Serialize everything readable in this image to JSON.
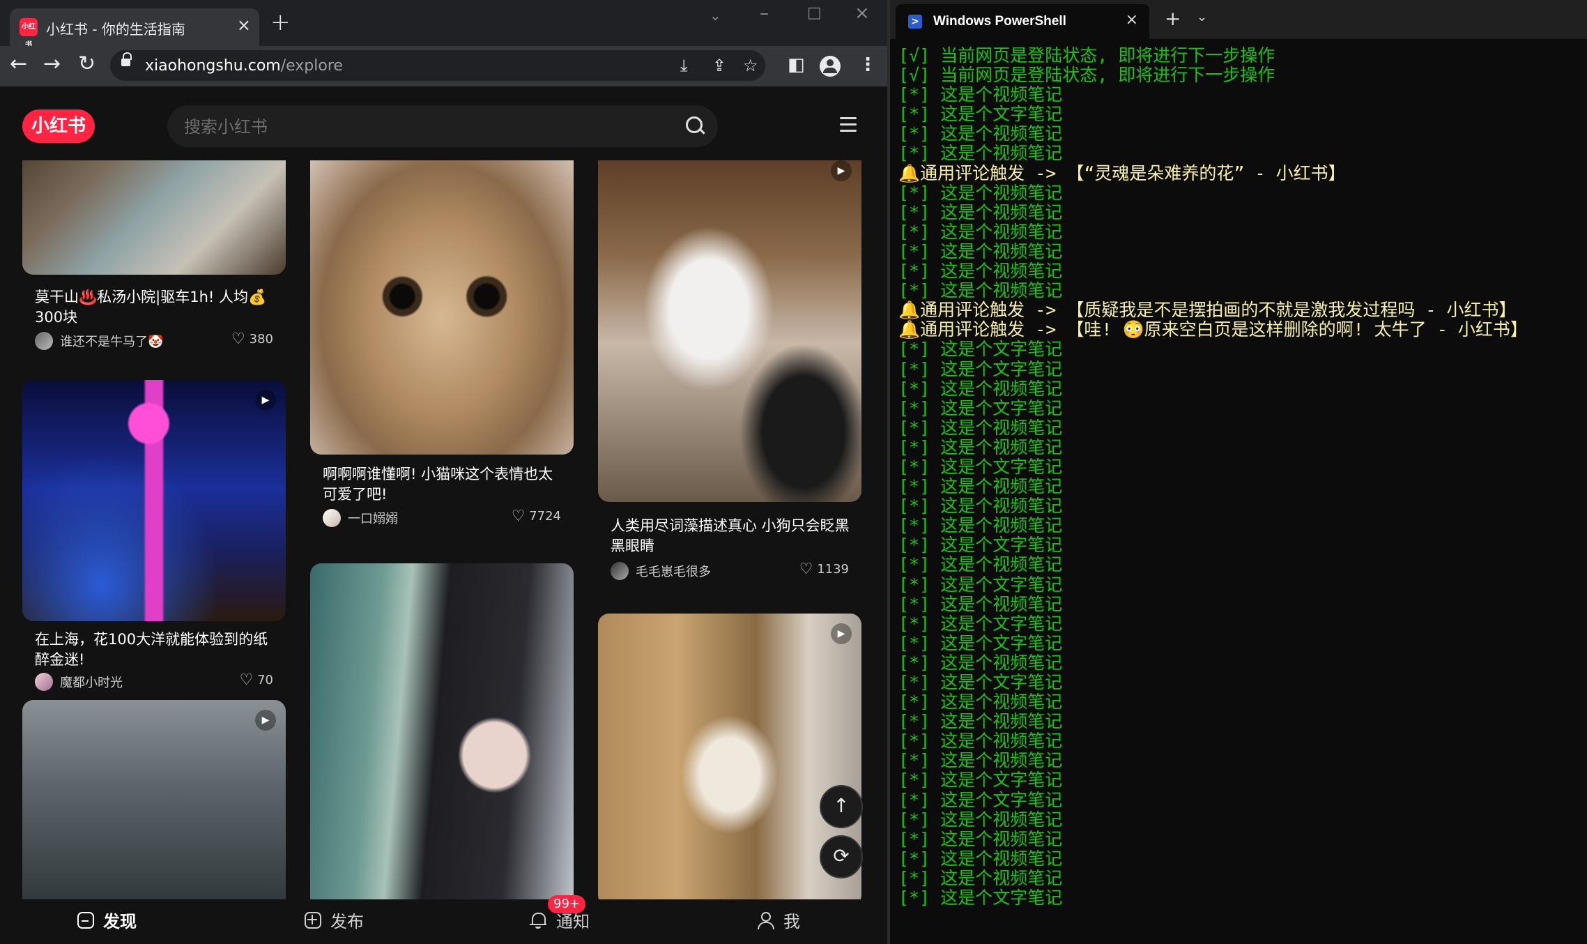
{
  "browser": {
    "tab_title": "小红书 - 你的生活指南",
    "tab_favicon_text": "小红书",
    "url_host": "xiaohongshu.com",
    "url_path": "/explore",
    "icons": [
      "back-icon",
      "forward-icon",
      "reload-icon",
      "lock-icon",
      "install-icon",
      "share-icon",
      "star-icon",
      "sidepanel-icon",
      "profile-icon",
      "more-icon"
    ]
  },
  "xhs": {
    "logo": "小红书",
    "search_placeholder": "搜索小红书",
    "brand_color": "#ff2442",
    "cards": [
      {
        "title": "莫干山♨️私汤小院|驱车1h! 人均💰300块",
        "author": "谁还不是牛马了🤡",
        "likes": "380",
        "video": false
      },
      {
        "title": "在上海，花100大洋就能体验到的纸醉金迷!",
        "author": "魔都小时光",
        "likes": "70",
        "video": true
      },
      {
        "title": "",
        "author": "",
        "likes": "",
        "video": true
      },
      {
        "title": "啊啊啊谁懂啊! 小猫咪这个表情也太可爱了吧!",
        "author": "一口嫋嫋",
        "likes": "7724",
        "video": false
      },
      {
        "title": "",
        "author": "",
        "likes": "",
        "video": false
      },
      {
        "title": "人类用尽词藻描述真心 小狗只会眨黑黑眼睛",
        "author": "毛毛崽毛很多",
        "likes": "1139",
        "video": true
      },
      {
        "title": "",
        "author": "",
        "likes": "",
        "video": true
      }
    ],
    "bottom_nav": [
      {
        "label": "发现",
        "active": true
      },
      {
        "label": "发布",
        "active": false
      },
      {
        "label": "通知",
        "active": false,
        "badge": "99+"
      },
      {
        "label": "我",
        "active": false
      }
    ]
  },
  "terminal": {
    "tab_title": "Windows PowerShell",
    "lines": [
      {
        "kind": "ok",
        "text": "[√] 当前网页是登陆状态, 即将进行下一步操作"
      },
      {
        "kind": "ok",
        "text": "[√] 当前网页是登陆状态, 即将进行下一步操作"
      },
      {
        "kind": "ok",
        "text": "[*] 这是个视频笔记"
      },
      {
        "kind": "ok",
        "text": "[*] 这是个文字笔记"
      },
      {
        "kind": "ok",
        "text": "[*] 这是个视频笔记"
      },
      {
        "kind": "ok",
        "text": "[*] 这是个视频笔记"
      },
      {
        "kind": "trig",
        "text": "通用评论触发 -> 【“灵魂是朵难养的花” - 小红书】"
      },
      {
        "kind": "ok",
        "text": "[*] 这是个视频笔记"
      },
      {
        "kind": "ok",
        "text": "[*] 这是个视频笔记"
      },
      {
        "kind": "ok",
        "text": "[*] 这是个视频笔记"
      },
      {
        "kind": "ok",
        "text": "[*] 这是个视频笔记"
      },
      {
        "kind": "ok",
        "text": "[*] 这是个视频笔记"
      },
      {
        "kind": "ok",
        "text": "[*] 这是个视频笔记"
      },
      {
        "kind": "trig",
        "text": "通用评论触发 -> 【质疑我是不是摆拍画的不就是激我发过程吗 - 小红书】"
      },
      {
        "kind": "trig",
        "text": "通用评论触发 -> 【哇! 😳原来空白页是这样删除的啊! 太牛了 - 小红书】"
      },
      {
        "kind": "ok",
        "text": "[*] 这是个文字笔记"
      },
      {
        "kind": "ok",
        "text": "[*] 这是个文字笔记"
      },
      {
        "kind": "ok",
        "text": "[*] 这是个视频笔记"
      },
      {
        "kind": "ok",
        "text": "[*] 这是个文字笔记"
      },
      {
        "kind": "ok",
        "text": "[*] 这是个视频笔记"
      },
      {
        "kind": "ok",
        "text": "[*] 这是个视频笔记"
      },
      {
        "kind": "ok",
        "text": "[*] 这是个文字笔记"
      },
      {
        "kind": "ok",
        "text": "[*] 这是个视频笔记"
      },
      {
        "kind": "ok",
        "text": "[*] 这是个视频笔记"
      },
      {
        "kind": "ok",
        "text": "[*] 这是个视频笔记"
      },
      {
        "kind": "ok",
        "text": "[*] 这是个文字笔记"
      },
      {
        "kind": "ok",
        "text": "[*] 这是个视频笔记"
      },
      {
        "kind": "ok",
        "text": "[*] 这是个文字笔记"
      },
      {
        "kind": "ok",
        "text": "[*] 这是个视频笔记"
      },
      {
        "kind": "ok",
        "text": "[*] 这是个文字笔记"
      },
      {
        "kind": "ok",
        "text": "[*] 这是个文字笔记"
      },
      {
        "kind": "ok",
        "text": "[*] 这是个视频笔记"
      },
      {
        "kind": "ok",
        "text": "[*] 这是个文字笔记"
      },
      {
        "kind": "ok",
        "text": "[*] 这是个视频笔记"
      },
      {
        "kind": "ok",
        "text": "[*] 这是个视频笔记"
      },
      {
        "kind": "ok",
        "text": "[*] 这是个视频笔记"
      },
      {
        "kind": "ok",
        "text": "[*] 这是个视频笔记"
      },
      {
        "kind": "ok",
        "text": "[*] 这是个文字笔记"
      },
      {
        "kind": "ok",
        "text": "[*] 这是个文字笔记"
      },
      {
        "kind": "ok",
        "text": "[*] 这是个视频笔记"
      },
      {
        "kind": "ok",
        "text": "[*] 这是个视频笔记"
      },
      {
        "kind": "ok",
        "text": "[*] 这是个视频笔记"
      },
      {
        "kind": "ok",
        "text": "[*] 这是个视频笔记"
      },
      {
        "kind": "ok",
        "text": "[*] 这是个文字笔记"
      }
    ]
  }
}
